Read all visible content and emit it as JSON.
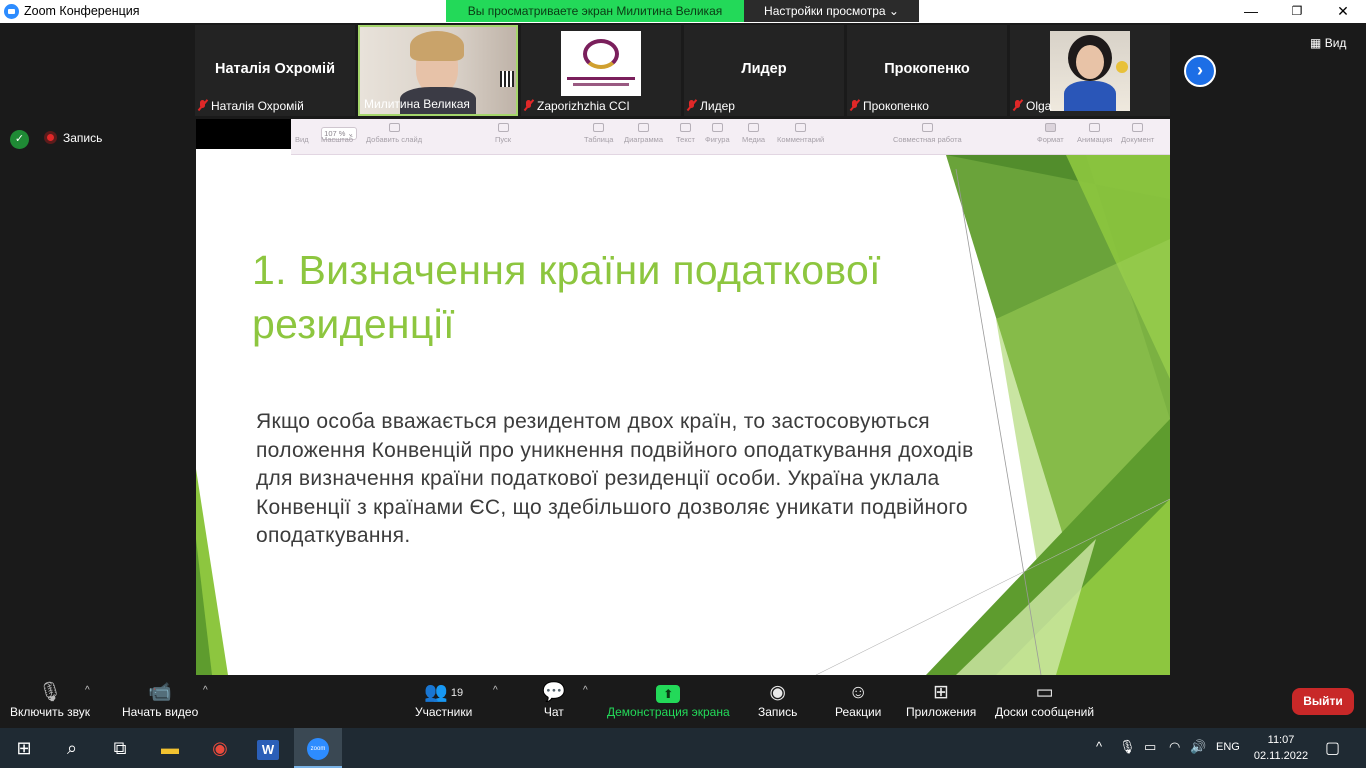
{
  "window": {
    "title": "Zoom Конференция",
    "min_glyph": "—",
    "max_glyph": "❐",
    "close_glyph": "✕"
  },
  "banner": {
    "viewing": "Вы просматриваете экран Милитина Великая",
    "settings": "Настройки просмотра",
    "settings_chevron": "⌄"
  },
  "view_button": "Вид",
  "view_icon": "▦",
  "participants": [
    {
      "display": "Наталія Охромій",
      "label": "Наталія Охромій",
      "type": "name"
    },
    {
      "display": "",
      "label": "Милитина Великая",
      "type": "video"
    },
    {
      "display": "",
      "label": "Zaporizhzhia CCI",
      "type": "logo"
    },
    {
      "display": "Лидер",
      "label": "Лидер",
      "type": "name"
    },
    {
      "display": "Прокопенко",
      "label": "Прокопенко",
      "type": "name"
    },
    {
      "display": "",
      "label": "Olga",
      "type": "photo"
    }
  ],
  "next_glyph": "›",
  "recording": {
    "label": "Запись"
  },
  "shield_glyph": "✓",
  "keynote_toolbar": {
    "zoom": "107 % ⌄",
    "items": [
      {
        "label": "Вид"
      },
      {
        "label": "Масштаб"
      },
      {
        "label": "Добавить слайд"
      },
      {
        "label": "Пуск"
      },
      {
        "label": "Таблица"
      },
      {
        "label": "Диаграмма"
      },
      {
        "label": "Текст"
      },
      {
        "label": "Фигура"
      },
      {
        "label": "Медиа"
      },
      {
        "label": "Комментарий"
      },
      {
        "label": "Совместная работа"
      },
      {
        "label": "Формат"
      },
      {
        "label": "Анимация"
      },
      {
        "label": "Документ"
      }
    ]
  },
  "slide": {
    "title": "1. Визначення країни податкової резиденції",
    "body": "Якщо особа вважається резидентом двох країн, то застосовуються положення Конвенцій про уникнення подвійного оподаткування доходів для визначення країни податкової резиденції особи. Україна уклала Конвенції з країнами ЄС, що здебільшого дозволяє уникати подвійного оподаткування.",
    "colors": {
      "title": "#8dc63f",
      "body": "#3c3c3c",
      "accent_dark": "#5e9c2e",
      "accent_light": "#cfe8a8"
    }
  },
  "toolbar": {
    "mute": {
      "label": "Включить звук",
      "icon": "🎙"
    },
    "video": {
      "label": "Начать видео",
      "icon": "📹"
    },
    "participants": {
      "label": "Участники",
      "count": "19",
      "icon": "👥"
    },
    "chat": {
      "label": "Чат",
      "icon": "💬"
    },
    "share": {
      "label": "Демонстрация экрана",
      "icon": "⬆"
    },
    "record": {
      "label": "Запись",
      "icon": "◉"
    },
    "reactions": {
      "label": "Реакции",
      "icon": "☺"
    },
    "apps": {
      "label": "Приложения",
      "icon": "⊞"
    },
    "whiteboards": {
      "label": "Доски сообщений",
      "icon": "▭"
    },
    "caret": "^",
    "leave": "Выйти"
  },
  "taskbar": {
    "start_icon": "⊞",
    "search_icon": "⌕",
    "taskview_icon": "⧉",
    "explorer_icon": "▬",
    "chrome_icon": "◉",
    "word_icon": "W",
    "zoom_icon": "zoom",
    "tray_up": "^",
    "mic_icon": "🎙",
    "battery_icon": "▭",
    "wifi_icon": "◠",
    "volume_icon": "🔊",
    "lang": "ENG",
    "time": "11:07",
    "date": "02.11.2022",
    "notify_icon": "▢"
  }
}
